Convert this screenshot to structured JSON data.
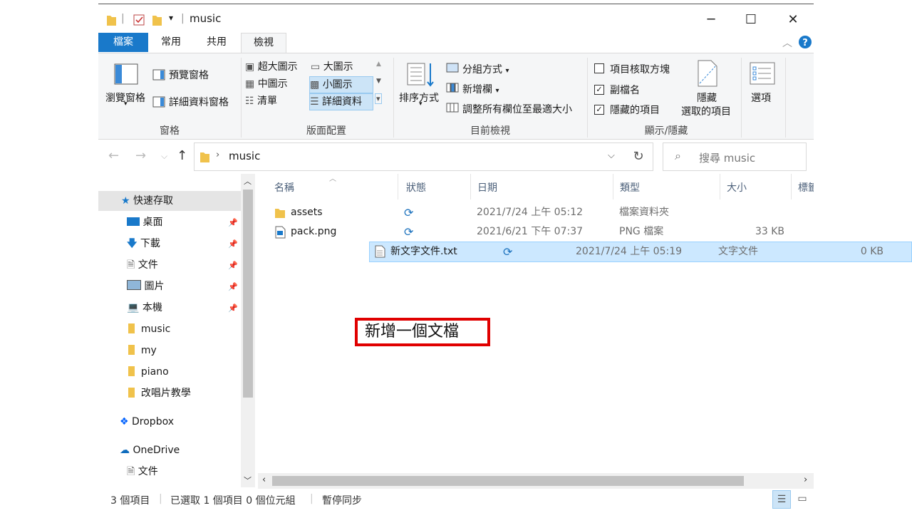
{
  "title": "music",
  "window_controls": {
    "minimize": "─",
    "maximize": "☐",
    "close": "✕"
  },
  "tabs": [
    {
      "label": "檔案"
    },
    {
      "label": "常用"
    },
    {
      "label": "共用"
    },
    {
      "label": "檢視"
    }
  ],
  "ribbon": {
    "panes": {
      "nav_pane": "瀏覽窗格",
      "preview_pane": "預覽窗格",
      "details_pane": "詳細資料窗格",
      "group_label": "窗格"
    },
    "layout": {
      "xl_icons": "超大圖示",
      "large_icons": "大圖示",
      "medium_icons": "中圖示",
      "small_icons": "小圖示",
      "list": "清單",
      "details": "詳細資料",
      "group_label": "版面配置"
    },
    "current_view": {
      "sort_by": "排序方式",
      "group_by": "分組方式",
      "add_columns": "新增欄",
      "size_all_columns": "調整所有欄位至最適大小",
      "group_label": "目前檢視"
    },
    "show_hide": {
      "item_checkboxes": "項目核取方塊",
      "item_checkboxes_checked": false,
      "file_extensions": "副檔名",
      "file_extensions_checked": true,
      "hidden_items": "隱藏的項目",
      "hidden_items_checked": true,
      "hide_selected_1": "隱藏",
      "hide_selected_2": "選取的項目",
      "group_label": "顯示/隱藏"
    },
    "options": "選項"
  },
  "address": {
    "path": "music",
    "search_placeholder": "搜尋 music"
  },
  "nav_pane": {
    "quick_access": "快速存取",
    "items": [
      {
        "label": "桌面",
        "pinned": true
      },
      {
        "label": "下載",
        "pinned": true
      },
      {
        "label": "文件",
        "pinned": true
      },
      {
        "label": "圖片",
        "pinned": true
      },
      {
        "label": "本機",
        "pinned": true
      },
      {
        "label": "music",
        "pinned": false
      },
      {
        "label": "my",
        "pinned": false
      },
      {
        "label": "piano",
        "pinned": false
      },
      {
        "label": "改唱片教學",
        "pinned": false
      }
    ],
    "dropbox": "Dropbox",
    "onedrive": "OneDrive",
    "onedrive_child": "文件"
  },
  "columns": {
    "name": "名稱",
    "status": "狀態",
    "date": "日期",
    "type": "類型",
    "size": "大小",
    "tags": "標籤"
  },
  "files": [
    {
      "name": "assets",
      "date": "2021/7/24 上午 05:12",
      "type": "檔案資料夾",
      "size": "",
      "icon": "folder-icon",
      "selected": false
    },
    {
      "name": "pack.png",
      "date": "2021/6/21 下午 07:37",
      "type": "PNG 檔案",
      "size": "33 KB",
      "icon": "image-file-icon",
      "selected": false
    },
    {
      "name": "新文字文件.txt",
      "date": "2021/7/24 上午 05:19",
      "type": "文字文件",
      "size": "0 KB",
      "icon": "text-file-icon",
      "selected": true
    }
  ],
  "status_bar": {
    "count": "3 個項目",
    "selected": "已選取 1 個項目 0 個位元組",
    "sync": "暫停同步"
  },
  "annotation": "新增一個文檔",
  "colors": {
    "accent": "#1979ca",
    "selection": "#cce8ff",
    "annotation_border": "#e00000",
    "folder": "#f0c24b"
  }
}
